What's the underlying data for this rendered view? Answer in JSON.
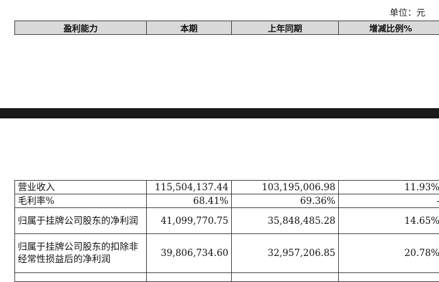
{
  "unit_label": "单位：元",
  "header": {
    "columns": [
      "盈利能力",
      "本期",
      "上年同期",
      "增减比例%"
    ]
  },
  "rows": [
    {
      "label": "营业收入",
      "current": "115,504,137.44",
      "previous": "103,195,006.98",
      "change": "11.93%"
    },
    {
      "label": "毛利率%",
      "current": "68.41%",
      "previous": "69.36%",
      "change": "-"
    },
    {
      "label": "归属于挂牌公司股东的净利润",
      "current": "41,099,770.75",
      "previous": "35,848,485.28",
      "change": "14.65%"
    },
    {
      "label": "归属于挂牌公司股东的扣除非经常性损益后的净利润",
      "current": "39,806,734.60",
      "previous": "32,957,206.85",
      "change": "20.78%"
    }
  ]
}
